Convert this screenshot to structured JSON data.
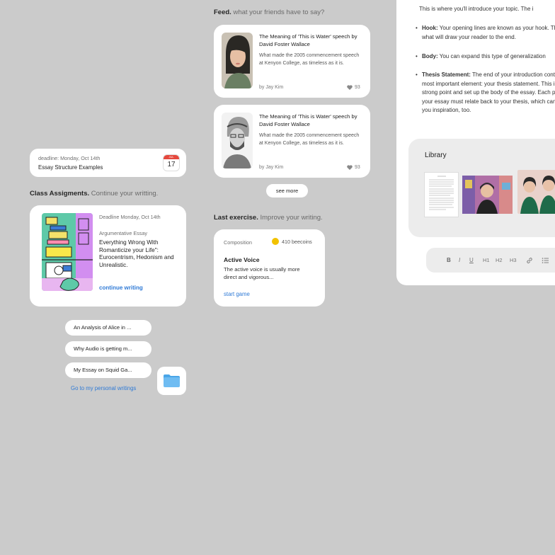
{
  "deadline_card": {
    "deadline": "deadline: Monday, Oct 14th",
    "title": "Essay Structure Examples",
    "calendar_month": "JUL",
    "calendar_day": "17"
  },
  "class_assignments": {
    "heading": "Class Assigments.",
    "subheading": "Continue your writting.",
    "card": {
      "deadline": "Deadline Monday, Oct 14th",
      "type": "Argumentative Essay",
      "title": "Everything Wrong With Romanticize your Life\": Eurocentrism, Hedonism and Unrealistic.",
      "action": "continue writing"
    }
  },
  "personal_writings": {
    "items": [
      "An Analysis of Alice in ...",
      "Why Audio is getting m...",
      "My Essay on Squid Ga..."
    ],
    "link": "Go to my personal writings"
  },
  "feed": {
    "heading": "Feed.",
    "subheading": "what your friends have to say?",
    "posts": [
      {
        "title": "The Meaning of 'This is Water' speech by David Foster Wallace",
        "description": "What made the 2005 commencement speech at Kenyon College, as timeless as it is.",
        "author": "by Jay Kim",
        "likes": "93"
      },
      {
        "title": "The Meaning of 'This is Water' speech by David Foster Wallace",
        "description": "What made the 2005 commencement speech at Kenyon College, as timeless as it is.",
        "author": "by Jay Kim",
        "likes": "93"
      }
    ],
    "see_more": "see more"
  },
  "last_exercise": {
    "heading": "Last exercise.",
    "subheading": "Improve your writing.",
    "card": {
      "category": "Composition",
      "coins": "410 beecoins",
      "title": "Active Voice",
      "description": "The active voice is usually more direct and vigorous...",
      "action": "start game"
    }
  },
  "document": {
    "intro": "This is where you'll introduce your topic. The i",
    "bullets": [
      {
        "term": "Hook:",
        "text": "Your opening lines are known as your hook. This is what will draw your reader to the end."
      },
      {
        "term": "Body:",
        "text": "You can expand this type of generalization"
      },
      {
        "term": "Thesis Statement:",
        "text": "The end of your introduction contains the most important element: your thesis statement. This is the strong point and set up the body of the essay. Each part of your essay must relate back to your thesis, which can give you inspiration, too."
      }
    ]
  },
  "library": {
    "title": "Library"
  },
  "toolbar": {
    "bold": "B",
    "italic": "I",
    "underline": "U",
    "h1": "H1",
    "h2": "H2",
    "h3": "H3"
  },
  "colors": {
    "background": "#cbcbcb",
    "link": "#2f7ad6",
    "card": "#ffffff",
    "coin": "#f2c200"
  }
}
